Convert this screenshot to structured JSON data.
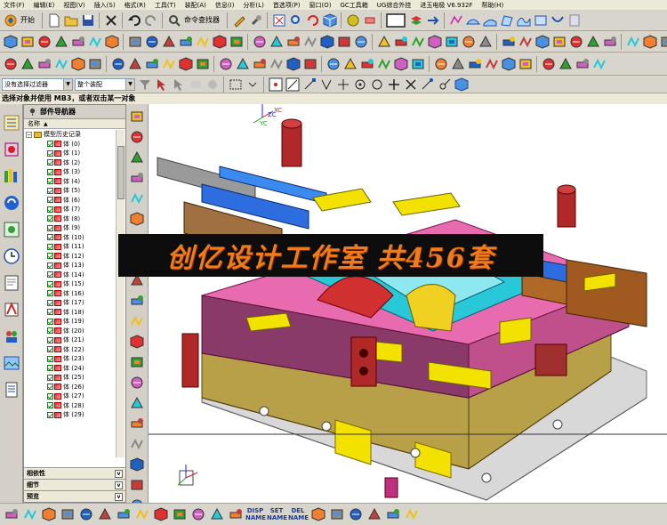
{
  "menu": [
    "文件(F)",
    "编辑(E)",
    "视图(V)",
    "插入(S)",
    "格式(R)",
    "工具(T)",
    "装配(A)",
    "信息(I)",
    "分析(L)",
    "首选项(P)",
    "窗口(O)",
    "GC工具箱",
    "UG综合外挂",
    "进玉电极 V6.932F",
    "帮助(H)"
  ],
  "toolbar": {
    "start_label": "开始",
    "command_finder_label": "命令查找器"
  },
  "selection": {
    "filter_value": "没有选择过滤器",
    "assembly_value": "整个装配"
  },
  "cue_line": "选择对象并使用 MB3，或者双击某一对象",
  "navigator": {
    "title": "部件导航器",
    "column_name": "名称",
    "root": "模型历史记录",
    "bodies": [
      "体 (0)",
      "体 (1)",
      "体 (2)",
      "体 (3)",
      "体 (4)",
      "体 (5)",
      "体 (6)",
      "体 (7)",
      "体 (8)",
      "体 (9)",
      "体 (10)",
      "体 (11)",
      "体 (12)",
      "体 (13)",
      "体 (14)",
      "体 (15)",
      "体 (16)",
      "体 (17)",
      "体 (18)",
      "体 (19)",
      "体 (20)",
      "体 (21)",
      "体 (22)",
      "体 (23)",
      "体 (24)",
      "体 (25)",
      "体 (26)",
      "体 (27)",
      "体 (28)",
      "体 (29)"
    ],
    "panels": [
      "相依性",
      "细节",
      "预览"
    ]
  },
  "banner_text": "创亿设计工作室  共456套",
  "viewport": {
    "axis_labels": [
      "ZC",
      "YC",
      "XC"
    ],
    "background": "#ffffff"
  },
  "bottom_text_buttons": [
    {
      "line1": "DISP",
      "line2": "NAME"
    },
    {
      "line1": "SET",
      "line2": "NAME"
    },
    {
      "line1": "DEL",
      "line2": "NAME"
    }
  ],
  "colors": {
    "mold_pink": "#e86bb0",
    "mold_yellow": "#f3e200",
    "mold_cyan": "#28c8d8",
    "mold_blue": "#2d6de0",
    "mold_red": "#b02828",
    "banner_orange": "#f07b1a"
  }
}
